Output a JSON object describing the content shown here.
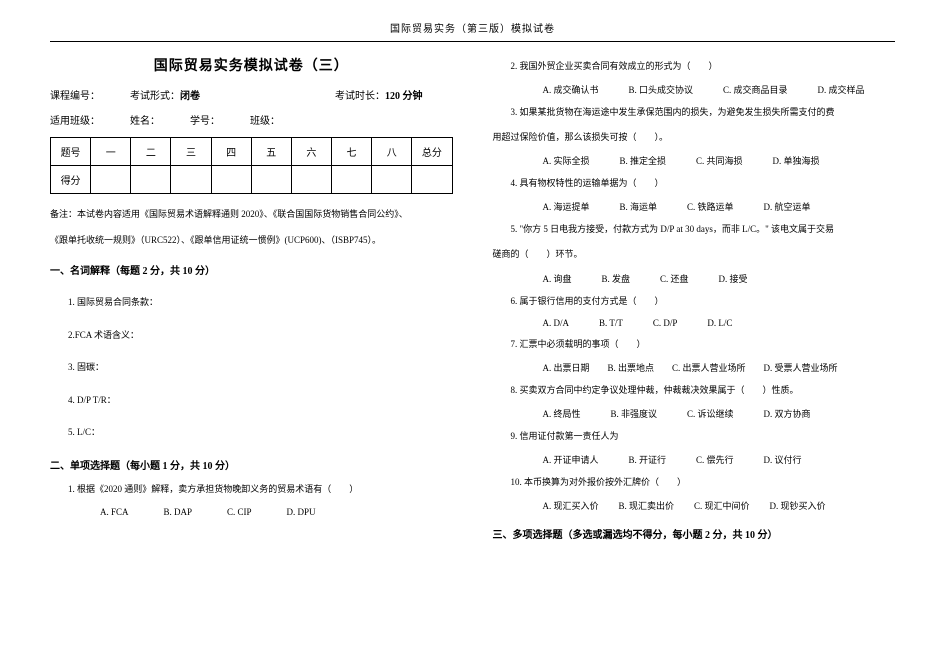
{
  "header": "国际贸易实务（第三版）模拟试卷",
  "title": "国际贸易实务模拟试卷（三）",
  "info1": {
    "course": "课程编号：",
    "form_label": "考试形式：",
    "form_value": "闭卷",
    "duration_label": "考试时长：",
    "duration_value": "120 分钟"
  },
  "info2": {
    "class": "适用班级：",
    "name": "姓名：",
    "id": "学号：",
    "grade": "班级："
  },
  "score": {
    "h": "题号",
    "c1": "一",
    "c2": "二",
    "c3": "三",
    "c4": "四",
    "c5": "五",
    "c6": "六",
    "c7": "七",
    "c8": "八",
    "total": "总分",
    "r2": "得分"
  },
  "note1": "备注：本试卷内容适用《国际贸易术语解释通则 2020》、《联合国国际货物销售合同公约》、",
  "note2": "《跟单托收统一规则》（URC522）、《跟单信用证统一惯例》(UCP600)、（ISBP745）。",
  "s1": {
    "title": "一、名词解释（每题 2 分，共 10 分）",
    "q1": "1. 国际贸易合同条款：",
    "q2": "2.FCA 术语含义：",
    "q3": "3. 固碳：",
    "q4": "4. D/P T/R：",
    "q5": "5. L/C："
  },
  "s2": {
    "title": "二、单项选择题（每小题 1 分，共 10 分）",
    "q1": "1. 根据《2020 通则》解释，卖方承担货物晚卸义务的贸易术语有（　　）",
    "q1o": {
      "a": "A. FCA",
      "b": "B. DAP",
      "c": "C. CIP",
      "d": "D. DPU"
    },
    "q2": "2. 我国外贸企业买卖合同有效成立的形式为（　　）",
    "q2o": {
      "a": "A. 成交确认书",
      "b": "B. 口头成交协议",
      "c": "C. 成交商品目录",
      "d": "D. 成交样品"
    },
    "q3": "3. 如果某批货物在海运途中发生承保范围内的损失，为避免发生损失所需支付的费",
    "q3b": "用超过保险价值，那么该损失可按（　　）。",
    "q3o": {
      "a": "A. 实际全损",
      "b": "B. 推定全损",
      "c": "C. 共同海损",
      "d": "D. 单独海损"
    },
    "q4": "4. 具有物权特性的运输单据为（　　）",
    "q4o": {
      "a": "A. 海运提单",
      "b": "B. 海运单",
      "c": "C. 铁路运单",
      "d": "D. 航空运单"
    },
    "q5": "5. \"你方 5 日电我方接受，付款方式为 D/P at 30 days，而非 L/C。\" 该电文属于交易",
    "q5b": "磋商的（　　）环节。",
    "q5o": {
      "a": "A. 询盘",
      "b": "B. 发盘",
      "c": "C. 还盘",
      "d": "D. 接受"
    },
    "q6": "6. 属于银行信用的支付方式是（　　）",
    "q6o": {
      "a": "A. D/A",
      "b": "B. T/T",
      "c": "C. D/P",
      "d": "D. L/C"
    },
    "q7": "7. 汇票中必须载明的事项（　　）",
    "q7o": {
      "a": "A. 出票日期",
      "b": "B. 出票地点",
      "c": "C. 出票人营业场所",
      "d": "D. 受票人营业场所"
    },
    "q8": "8. 买卖双方合同中约定争议处理仲裁，仲裁裁决效果属于（　　）性质。",
    "q8o": {
      "a": "A. 终局性",
      "b": "B. 非强度议",
      "c": "C. 诉讼继续",
      "d": "D. 双方协商"
    },
    "q9": "9. 信用证付款第一责任人为",
    "q9o": {
      "a": "A. 开证申请人",
      "b": "B. 开证行",
      "c": "C. 偿先行",
      "d": "D. 议付行"
    },
    "q10": "10. 本币换算为对外报价按外汇牌价（　　）",
    "q10o": {
      "a": "A. 现汇买入价",
      "b": "B. 现汇卖出价",
      "c": "C. 现汇中间价",
      "d": "D. 现钞买入价"
    }
  },
  "s3": {
    "title": "三、多项选择题（多选或漏选均不得分，每小题 2 分，共 10 分）"
  }
}
